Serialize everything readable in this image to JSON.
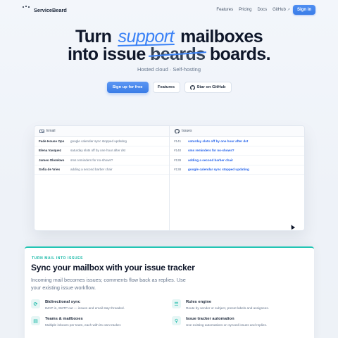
{
  "nav": {
    "brand": "ServiceBeard",
    "links": [
      "Features",
      "Pricing",
      "Docs",
      "GitHub"
    ],
    "signin": "Sign in"
  },
  "hero": {
    "line1_a": "Turn",
    "line1_accent": "support",
    "line1_b": "mailboxes",
    "line2_a": "into issue",
    "line2_strike": "beards",
    "line2_b": "boards.",
    "subtitle": "Hosted cloud · Self-hosting",
    "cta_primary": "Sign up for free",
    "cta_features": "Features",
    "cta_github": "Star on GitHub"
  },
  "inbox": {
    "email_label": "Email",
    "issues_label": "Issues",
    "emails": [
      {
        "sender": "Fade House Ops",
        "subject": "google calendar sync stopped updating"
      },
      {
        "sender": "Elena Vasquez",
        "subject": "saturday slots off by one hour after dst"
      },
      {
        "sender": "James Okonkwo",
        "subject": "sms reminders for no-shows?"
      },
      {
        "sender": "Sofia de Vries",
        "subject": "adding a second barber chair"
      }
    ],
    "issues": [
      {
        "num": "#141",
        "title": "saturday slots off by one hour after dst"
      },
      {
        "num": "#140",
        "title": "sms reminders for no-shows?"
      },
      {
        "num": "#139",
        "title": "adding a second barber chair"
      },
      {
        "num": "#138",
        "title": "google calendar sync stopped updating"
      }
    ]
  },
  "features": {
    "eyebrow": "TURN MAIL INTO ISSUES",
    "title": "Sync your mailbox with your issue tracker",
    "description": "Incoming mail becomes issues; comments flow back as replies. Use your existing issue workflow.",
    "items": [
      {
        "title": "Bidirectional sync",
        "desc": "IMAP in, SMTP out — issues and email stay threaded.",
        "icon": "sync-icon"
      },
      {
        "title": "Rules engine",
        "desc": "Route by sender or subject, preset labels and assignees.",
        "icon": "rules-icon"
      },
      {
        "title": "Teams & mailboxes",
        "desc": "Multiple inboxes per team, each with its own tracker.",
        "icon": "inbox-icon"
      },
      {
        "title": "Issue tracker automation",
        "desc": "Use existing automations on synced issues and replies.",
        "icon": "automation-icon"
      }
    ]
  }
}
